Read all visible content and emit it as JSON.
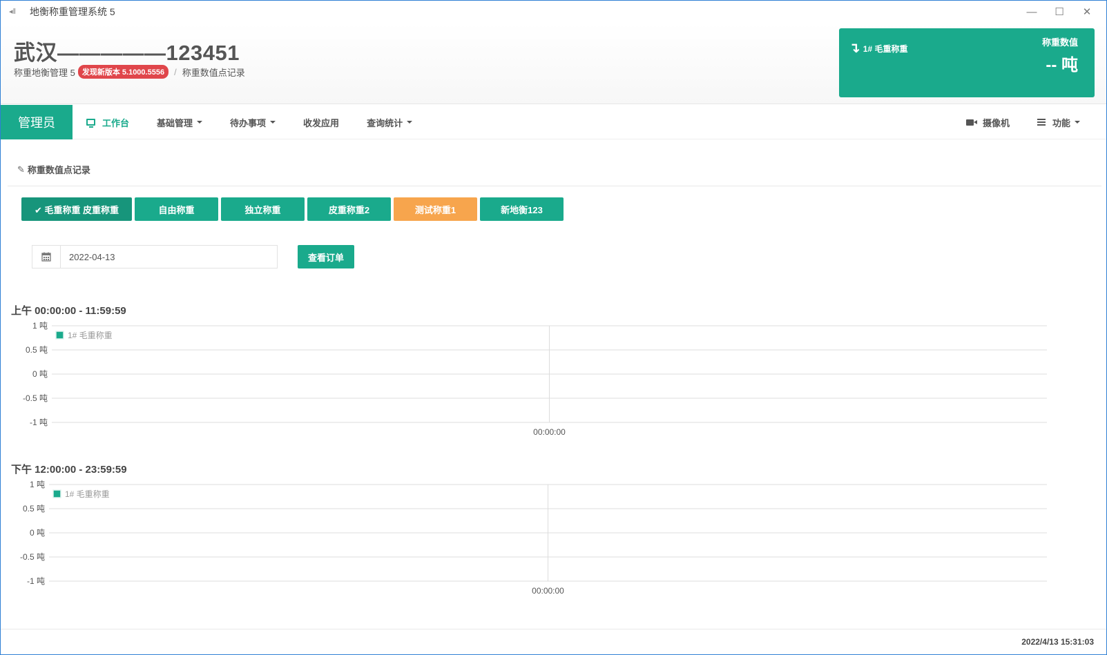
{
  "window": {
    "title": "地衡称重管理系统 5",
    "controls": {
      "minimize": "—",
      "maximize": "☐",
      "close": "✕"
    }
  },
  "header": {
    "company": "武汉—————123451",
    "breadcrumb": {
      "app": "称重地衡管理 5",
      "badge": "发现新版本 5.1000.5556",
      "separator": "/",
      "page": "称重数值点记录"
    },
    "weigh_card": {
      "station": "1# 毛重称重",
      "label": "称重数值",
      "value": "-- 吨"
    }
  },
  "nav": {
    "user": "管理员",
    "items": [
      {
        "label": "工作台",
        "dropdown": false,
        "active": true
      },
      {
        "label": "基础管理",
        "dropdown": true
      },
      {
        "label": "待办事项",
        "dropdown": true
      },
      {
        "label": "收发应用",
        "dropdown": false
      },
      {
        "label": "查询统计",
        "dropdown": true
      }
    ],
    "right": {
      "camera": "摄像机",
      "functions": "功能"
    }
  },
  "content": {
    "title": "称重数值点记录",
    "scale_buttons": [
      {
        "label": "✔ 毛重称重 皮重称重",
        "state": "selected"
      },
      {
        "label": "自由称重",
        "state": "normal"
      },
      {
        "label": "独立称重",
        "state": "normal"
      },
      {
        "label": "皮重称重2",
        "state": "normal"
      },
      {
        "label": "测试称重1",
        "state": "warning"
      },
      {
        "label": "新地衡123",
        "state": "normal"
      }
    ],
    "date": {
      "value": "2022-04-13",
      "placeholder": ""
    },
    "query_button": "查看订单"
  },
  "chart_data": [
    {
      "type": "line",
      "title": "上午 00:00:00 - 11:59:59",
      "categories": [
        "00:00:00"
      ],
      "series": [
        {
          "name": "1# 毛重称重",
          "values": []
        }
      ],
      "y_ticks": [
        "1 吨",
        "0.5 吨",
        "0 吨",
        "-0.5 吨",
        "-1 吨"
      ],
      "ylim": [
        -1,
        1
      ],
      "grid": true,
      "legend": "top-left"
    },
    {
      "type": "line",
      "title": "下午 12:00:00 - 23:59:59",
      "categories": [
        "00:00:00"
      ],
      "series": [
        {
          "name": "1# 毛重称重",
          "values": []
        }
      ],
      "y_ticks": [
        "1 吨",
        "0.5 吨",
        "0 吨",
        "-0.5 吨",
        "-1 吨"
      ],
      "ylim": [
        -1,
        1
      ],
      "grid": true,
      "legend": "top-left"
    }
  ],
  "colors": {
    "primary": "#1aaa8c",
    "warning": "#f7a54d",
    "badge": "#e0464b"
  },
  "footer": {
    "clock": "2022/4/13 15:31:03"
  }
}
